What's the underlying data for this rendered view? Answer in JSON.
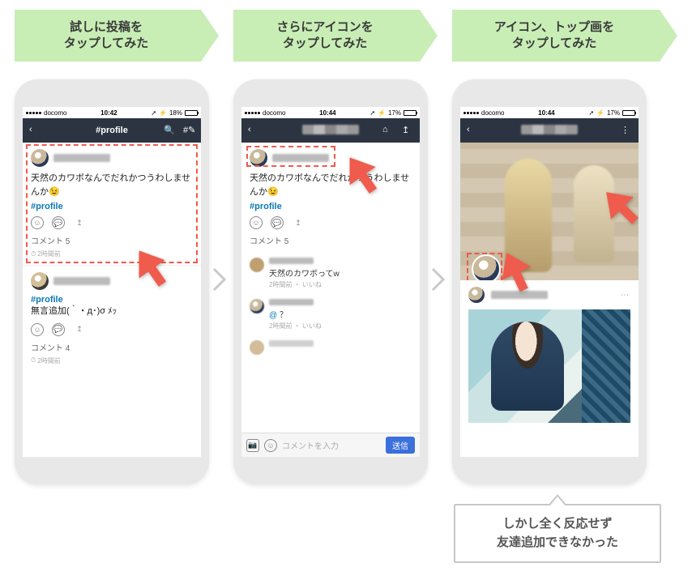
{
  "steps": {
    "s1": {
      "line1": "試しに投稿を",
      "line2": "タップしてみた"
    },
    "s2": {
      "line1": "さらにアイコンを",
      "line2": "タップしてみた"
    },
    "s3": {
      "line1": "アイコン、トップ画を",
      "line2": "タップしてみた"
    }
  },
  "status": {
    "carrier": "docomo",
    "time1": "10:42",
    "time2": "10:44",
    "time3": "10:44",
    "bt1": "18%",
    "bt2": "17%",
    "bt3": "17%",
    "bt_icon": "⚡",
    "loc_icon": "➚"
  },
  "nav": {
    "back": "‹",
    "title1": "#profile",
    "search": "🔍",
    "hash": "#✎",
    "home": "⌂",
    "share": "↥",
    "more": "⋮"
  },
  "post1": {
    "text": "天然のカワボなんでだれかつうわしませんか",
    "emoji": "😉",
    "hashtag": "#profile",
    "comments": "コメント 5",
    "time": "2時間前"
  },
  "post2": {
    "hashtag": "#profile",
    "text": "無言追加(｀・д･)σ ﾒｯ",
    "comments": "コメント 4",
    "time": "2時間前"
  },
  "p2post": {
    "text": "天然のカワボなんでだれかつうわしませんか",
    "emoji": "😉",
    "hashtag": "#profile",
    "comments": "コメント 5"
  },
  "p2comments": {
    "c1": {
      "text": "天然のカワボってw",
      "meta": "2時間前 ・ いいね"
    },
    "c2": {
      "text_prefix": "@",
      "text_suffix": " ？",
      "meta": "2時間前 ・ いいね"
    }
  },
  "input": {
    "placeholder": "コメントを入力",
    "send": "送信"
  },
  "actions": {
    "smile": "☺",
    "comment": "💬",
    "share": "↥",
    "clock": "⏱"
  },
  "speech": {
    "line1": "しかし全く反応せず",
    "line2": "友達追加できなかった"
  }
}
